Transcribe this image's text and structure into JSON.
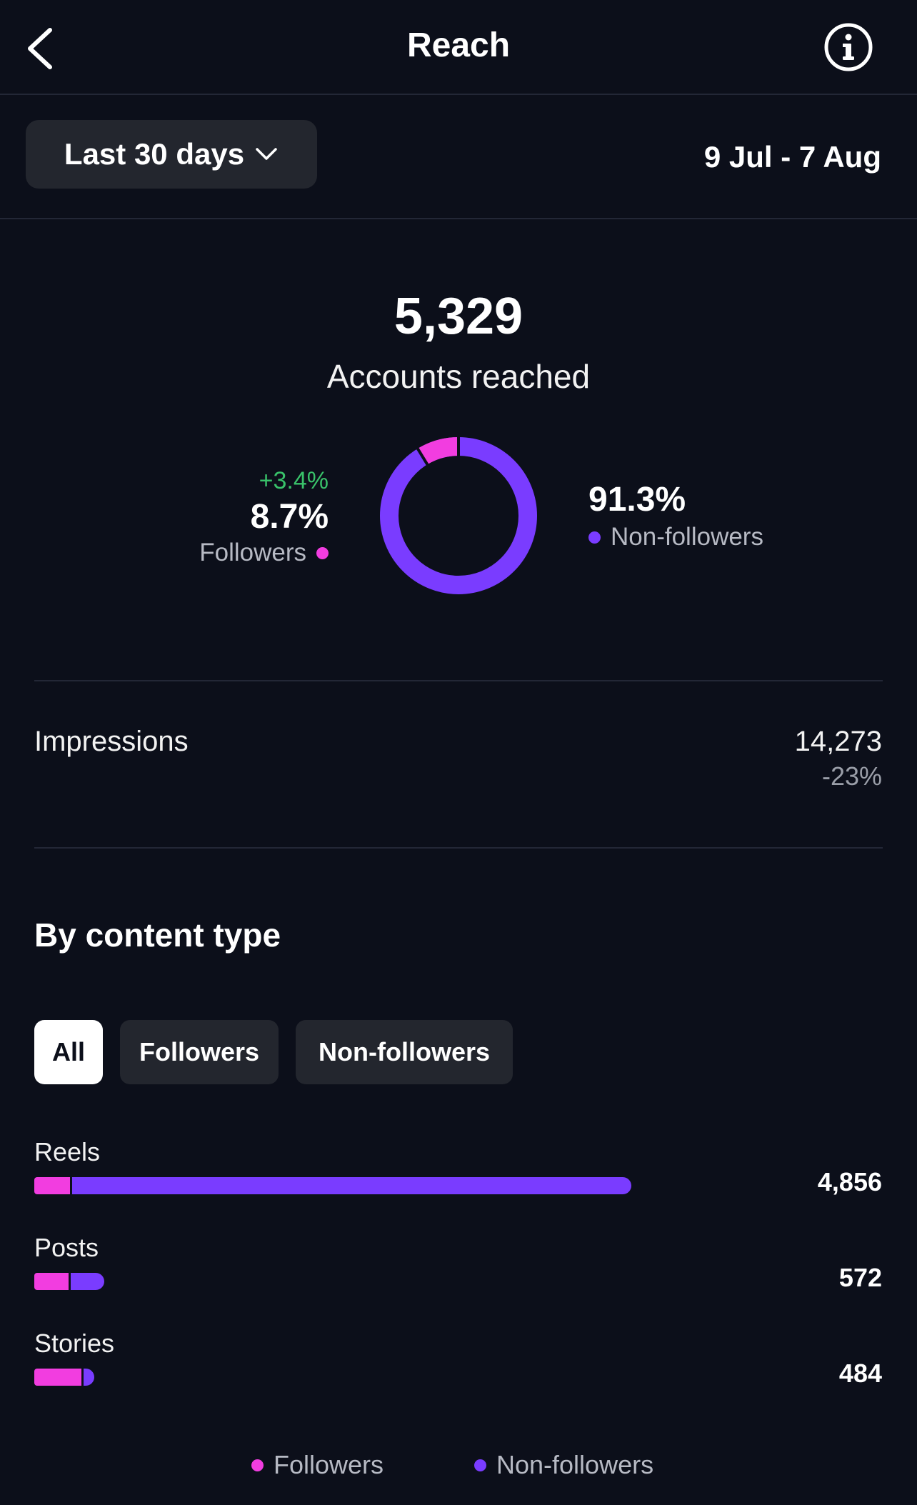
{
  "header": {
    "title": "Reach",
    "back_icon": "chevron-left-icon",
    "info_icon": "info-icon"
  },
  "filter": {
    "range_label": "Last 30 days",
    "dropdown_icon": "chevron-down-icon",
    "date_range": "9 Jul - 7 Aug"
  },
  "summary": {
    "accounts_reached": "5,329",
    "accounts_reached_label": "Accounts reached",
    "followers": {
      "change": "+3.4%",
      "percent": "8.7%",
      "label": "Followers"
    },
    "non_followers": {
      "percent": "91.3%",
      "label": "Non-followers"
    }
  },
  "impressions": {
    "label": "Impressions",
    "value": "14,273",
    "change": "-23%"
  },
  "content_type": {
    "title": "By content type",
    "tabs": [
      {
        "label": "All",
        "active": true
      },
      {
        "label": "Followers",
        "active": false
      },
      {
        "label": "Non-followers",
        "active": false
      }
    ],
    "rows": [
      {
        "label": "Reels",
        "value": "4,856",
        "total": 4856,
        "followers_share": 0.06
      },
      {
        "label": "Posts",
        "value": "572",
        "total": 572,
        "followers_share": 0.49
      },
      {
        "label": "Stories",
        "value": "484",
        "total": 484,
        "followers_share": 0.79
      }
    ]
  },
  "legend": {
    "followers": "Followers",
    "non_followers": "Non-followers"
  },
  "colors": {
    "background": "#0c0f1a",
    "followers": "#f23de0",
    "non_followers": "#7a3cff",
    "positive": "#39c26a",
    "chip": "#23262e"
  },
  "chart_data": {
    "type": "pie",
    "categories": [
      "Followers",
      "Non-followers"
    ],
    "values": [
      8.7,
      91.3
    ]
  }
}
